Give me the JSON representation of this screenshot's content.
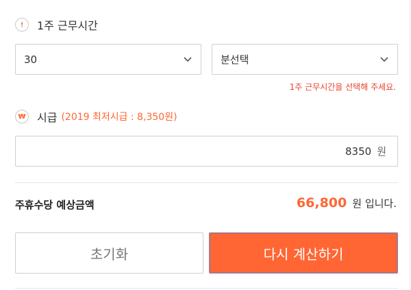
{
  "hours": {
    "label": "1주 근무시간",
    "hours_select_value": "30",
    "minutes_select_value": "분선택",
    "hint": "1주 근무시간을 선택해 주세요."
  },
  "wage": {
    "label": "시급",
    "min_wage_note": "(2019 최저시급 : 8,350원)",
    "value": "8350",
    "unit": "원",
    "icon_glyph": "₩"
  },
  "result": {
    "label": "주휴수당 예상금액",
    "amount": "66,800",
    "suffix": "원 입니다."
  },
  "buttons": {
    "reset_label": "초기화",
    "calc_label": "다시 계산하기"
  },
  "colors": {
    "accent": "#ff6633",
    "hint_red": "#e8432f",
    "border": "#cfcfcf"
  },
  "icons": {
    "hours_icon": "compass-clock-icon",
    "wage_icon": "won-icon",
    "select_arrow": "chevron-down-icon"
  }
}
